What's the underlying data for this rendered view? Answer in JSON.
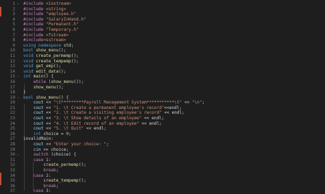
{
  "colors": {
    "background": "#1e1e1e",
    "line_number": "#858585",
    "preprocessor": "#c586c0",
    "keyword": "#569cd6",
    "control": "#c586c0",
    "function": "#dcdcaa",
    "string": "#ce9178",
    "number": "#b5cea8",
    "variable": "#9cdcfe",
    "plain": "#d4d4d4",
    "git_marker": "#c74e39"
  },
  "fold_icon": "chevron-down-icon",
  "lines": [
    {
      "n": "1",
      "fold": true,
      "indent": "",
      "tokens": [
        {
          "t": "#include ",
          "c": "pp"
        },
        {
          "t": "<iostream>",
          "c": "inc"
        }
      ]
    },
    {
      "n": "2",
      "indent": "",
      "tokens": [
        {
          "t": "#include ",
          "c": "pp"
        },
        {
          "t": "<string>",
          "c": "inc"
        }
      ]
    },
    {
      "n": "3",
      "indent": "",
      "tokens": [
        {
          "t": "#include ",
          "c": "pp"
        },
        {
          "t": "\"employee.h\"",
          "c": "inc"
        }
      ]
    },
    {
      "n": "4",
      "indent": "",
      "tokens": [
        {
          "t": "#include ",
          "c": "pp"
        },
        {
          "t": "\"SalaryInHand.h\"",
          "c": "inc"
        }
      ]
    },
    {
      "n": "5",
      "indent": "",
      "tokens": [
        {
          "t": "#include ",
          "c": "pp"
        },
        {
          "t": "\"Permanent.h\"",
          "c": "inc"
        }
      ]
    },
    {
      "n": "6",
      "indent": "",
      "tokens": [
        {
          "t": "#include ",
          "c": "pp"
        },
        {
          "t": "\"Temporary.h\"",
          "c": "inc"
        }
      ]
    },
    {
      "n": "7",
      "indent": "",
      "tokens": [
        {
          "t": "#include ",
          "c": "pp"
        },
        {
          "t": "<fstream>",
          "c": "inc"
        }
      ]
    },
    {
      "n": "8",
      "indent": "",
      "tokens": [
        {
          "t": "#include",
          "c": "pp"
        },
        {
          "t": "<sstream>",
          "c": "inc"
        }
      ]
    },
    {
      "n": "9",
      "indent": "",
      "tokens": [
        {
          "t": "using ",
          "c": "kw"
        },
        {
          "t": "namespace ",
          "c": "kw"
        },
        {
          "t": "std;",
          "c": "plain"
        }
      ]
    },
    {
      "n": "10",
      "indent": "",
      "tokens": [
        {
          "t": "bool ",
          "c": "kw"
        },
        {
          "t": "show_menu",
          "c": "fn"
        },
        {
          "t": "();",
          "c": "plain"
        }
      ]
    },
    {
      "n": "11",
      "indent": "",
      "tokens": [
        {
          "t": "void ",
          "c": "kw"
        },
        {
          "t": "create_permemp",
          "c": "fn"
        },
        {
          "t": "();",
          "c": "plain"
        }
      ]
    },
    {
      "n": "12",
      "indent": "",
      "tokens": [
        {
          "t": "void ",
          "c": "kw"
        },
        {
          "t": "create_tempemp",
          "c": "fn"
        },
        {
          "t": "();",
          "c": "plain"
        }
      ]
    },
    {
      "n": "13",
      "indent": "",
      "tokens": [
        {
          "t": "void ",
          "c": "kw"
        },
        {
          "t": "get_emp",
          "c": "fn"
        },
        {
          "t": "();",
          "c": "plain"
        }
      ]
    },
    {
      "n": "14",
      "indent": "",
      "tokens": [
        {
          "t": "void ",
          "c": "kw"
        },
        {
          "t": "edit_data",
          "c": "fn"
        },
        {
          "t": "();",
          "c": "plain"
        }
      ]
    },
    {
      "n": "15",
      "fold": true,
      "indent": "",
      "tokens": [
        {
          "t": "int ",
          "c": "kw"
        },
        {
          "t": "main",
          "c": "fn"
        },
        {
          "t": "() {",
          "c": "plain"
        }
      ]
    },
    {
      "n": "16",
      "indent": "    ",
      "tokens": [
        {
          "t": "while ",
          "c": "ctl"
        },
        {
          "t": "(",
          "c": "plain"
        },
        {
          "t": "show_menu",
          "c": "fn"
        },
        {
          "t": "());",
          "c": "plain"
        }
      ]
    },
    {
      "n": "17",
      "indent": "    ",
      "tokens": [
        {
          "t": "show_menu",
          "c": "fn"
        },
        {
          "t": "();",
          "c": "plain"
        }
      ]
    },
    {
      "n": "18",
      "indent": "",
      "tokens": [
        {
          "t": "}",
          "c": "plain"
        }
      ]
    },
    {
      "n": "19",
      "fold": true,
      "indent": "",
      "tokens": [
        {
          "t": "bool ",
          "c": "kw"
        },
        {
          "t": "show_menu",
          "c": "fn"
        },
        {
          "t": "() {",
          "c": "plain"
        }
      ]
    },
    {
      "n": "20",
      "indent": "    ",
      "tokens": [
        {
          "t": "cout ",
          "c": "var"
        },
        {
          "t": "<< ",
          "c": "plain"
        },
        {
          "t": "\"\\t*********Payroll Management System***********\\t\"",
          "c": "str"
        },
        {
          "t": " << ",
          "c": "plain"
        },
        {
          "t": "\"\\n\"",
          "c": "str"
        },
        {
          "t": ";",
          "c": "plain"
        }
      ]
    },
    {
      "n": "21",
      "indent": "    ",
      "tokens": [
        {
          "t": "cout ",
          "c": "var"
        },
        {
          "t": "<< ",
          "c": "plain"
        },
        {
          "t": "\"1. \\t Create a permanent employee's record\"",
          "c": "str"
        },
        {
          "t": "<<endl;",
          "c": "plain"
        }
      ]
    },
    {
      "n": "22",
      "indent": "    ",
      "tokens": [
        {
          "t": "cout ",
          "c": "var"
        },
        {
          "t": "<< ",
          "c": "plain"
        },
        {
          "t": "\"2. \\t Create a visiting employee's record\"",
          "c": "str"
        },
        {
          "t": " << endl;",
          "c": "plain"
        }
      ]
    },
    {
      "n": "23",
      "indent": "    ",
      "tokens": [
        {
          "t": "cout ",
          "c": "var"
        },
        {
          "t": "<< ",
          "c": "plain"
        },
        {
          "t": "\"3. \\t Show details of an employee\"",
          "c": "str"
        },
        {
          "t": " << endl;",
          "c": "plain"
        }
      ]
    },
    {
      "n": "24",
      "indent": "    ",
      "tokens": [
        {
          "t": "cout ",
          "c": "var"
        },
        {
          "t": "<< ",
          "c": "plain"
        },
        {
          "t": "\"4. \\t Edit record of an employee\"",
          "c": "str"
        },
        {
          "t": " << endl;",
          "c": "plain"
        }
      ]
    },
    {
      "n": "25",
      "indent": "    ",
      "tokens": [
        {
          "t": "cout ",
          "c": "var"
        },
        {
          "t": "<< ",
          "c": "plain"
        },
        {
          "t": "\"5. \\t Quit\"",
          "c": "str"
        },
        {
          "t": " << endl;",
          "c": "plain"
        }
      ]
    },
    {
      "n": "26",
      "indent": "    ",
      "tokens": [
        {
          "t": "int ",
          "c": "kw"
        },
        {
          "t": "choice = ",
          "c": "plain"
        },
        {
          "t": "0",
          "c": "num"
        },
        {
          "t": ";",
          "c": "plain"
        }
      ]
    },
    {
      "n": "27",
      "indent": "",
      "tokens": [
        {
          "t": "invalidMain:",
          "c": "lbl"
        }
      ]
    },
    {
      "n": "28",
      "indent": "    ",
      "tokens": [
        {
          "t": "cout ",
          "c": "var"
        },
        {
          "t": "<< ",
          "c": "plain"
        },
        {
          "t": "\"Enter your choice: \"",
          "c": "str"
        },
        {
          "t": ";",
          "c": "plain"
        }
      ]
    },
    {
      "n": "29",
      "indent": "    ",
      "tokens": [
        {
          "t": "cin ",
          "c": "var"
        },
        {
          "t": ">> choice;",
          "c": "plain"
        }
      ]
    },
    {
      "n": "30",
      "fold": true,
      "indent": "    ",
      "tokens": [
        {
          "t": "switch ",
          "c": "ctl"
        },
        {
          "t": "(choice) {",
          "c": "plain"
        }
      ]
    },
    {
      "n": "31",
      "indent": "    ",
      "tokens": [
        {
          "t": "case ",
          "c": "ctl"
        },
        {
          "t": "1",
          "c": "num"
        },
        {
          "t": ":",
          "c": "plain"
        }
      ]
    },
    {
      "n": "32",
      "indent": "        ",
      "tokens": [
        {
          "t": "create_permemp",
          "c": "fn"
        },
        {
          "t": "();",
          "c": "plain"
        }
      ]
    },
    {
      "n": "33",
      "indent": "        ",
      "tokens": [
        {
          "t": "break",
          "c": "ctl"
        },
        {
          "t": ";",
          "c": "plain"
        }
      ]
    },
    {
      "n": "34",
      "indent": "    ",
      "tokens": [
        {
          "t": "case ",
          "c": "ctl"
        },
        {
          "t": "2",
          "c": "num"
        },
        {
          "t": ":",
          "c": "plain"
        }
      ]
    },
    {
      "n": "35",
      "indent": "        ",
      "tokens": [
        {
          "t": "create_tempemp",
          "c": "fn"
        },
        {
          "t": "();",
          "c": "plain"
        }
      ]
    },
    {
      "n": "36",
      "indent": "        ",
      "tokens": [
        {
          "t": "break",
          "c": "ctl"
        },
        {
          "t": ";",
          "c": "plain"
        }
      ]
    },
    {
      "n": "37",
      "indent": "    ",
      "tokens": [
        {
          "t": "case ",
          "c": "ctl"
        },
        {
          "t": "3",
          "c": "num"
        },
        {
          "t": ":",
          "c": "plain"
        }
      ]
    }
  ]
}
